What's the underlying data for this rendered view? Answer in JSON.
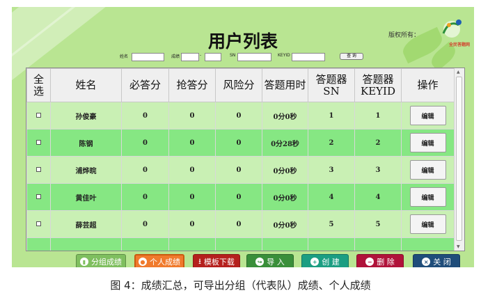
{
  "header": {
    "title": "用户列表",
    "copyright_label": "版权所有：",
    "logo_text": "全民答题网"
  },
  "search": {
    "name_label": "姓名",
    "score_label": "成绩",
    "range_sep": "-",
    "sn_label": "SN",
    "keyid_label": "KEYID",
    "query_button": "查 询"
  },
  "table": {
    "headers": [
      "全选",
      "姓名",
      "必答分",
      "抢答分",
      "风险分",
      "答题用时",
      "答题器SN",
      "答题器KEYID",
      "操作"
    ],
    "rows": [
      {
        "name": "孙俊豪",
        "required": "0",
        "rush": "0",
        "risk": "0",
        "time": "0分0秒",
        "sn": "1",
        "keyid": "1",
        "action": "编辑"
      },
      {
        "name": "陈钢",
        "required": "0",
        "rush": "0",
        "risk": "0",
        "time": "0分28秒",
        "sn": "2",
        "keyid": "2",
        "action": "编辑"
      },
      {
        "name": "浦烨晥",
        "required": "0",
        "rush": "0",
        "risk": "0",
        "time": "0分0秒",
        "sn": "3",
        "keyid": "3",
        "action": "编辑"
      },
      {
        "name": "黄佳叶",
        "required": "0",
        "rush": "0",
        "risk": "0",
        "time": "0分0秒",
        "sn": "4",
        "keyid": "4",
        "action": "编辑"
      },
      {
        "name": "薛芸超",
        "required": "0",
        "rush": "0",
        "risk": "0",
        "time": "0分0秒",
        "sn": "5",
        "keyid": "5",
        "action": "编辑"
      }
    ],
    "row_colors": {
      "odd": "#c9f0b4",
      "even": "#86e783"
    }
  },
  "buttons": [
    {
      "label": "分组成绩",
      "icon": "chart-icon",
      "color": "#7fbf5f"
    },
    {
      "label": "个人成绩",
      "icon": "person-icon",
      "color": "#f07a2c"
    },
    {
      "label": "模板下载",
      "icon": "download-icon",
      "color": "#b5201d"
    },
    {
      "label": "导 入",
      "icon": "import-icon",
      "color": "#3a8f3a"
    },
    {
      "label": "创 建",
      "icon": "plus-icon",
      "color": "#1b9e82"
    },
    {
      "label": "删 除",
      "icon": "minus-icon",
      "color": "#b0123a"
    },
    {
      "label": "关 闭",
      "icon": "close-icon",
      "color": "#1f4d7a"
    }
  ],
  "caption": "图 4：成绩汇总，可导出分组（代表队）成绩、个人成绩"
}
